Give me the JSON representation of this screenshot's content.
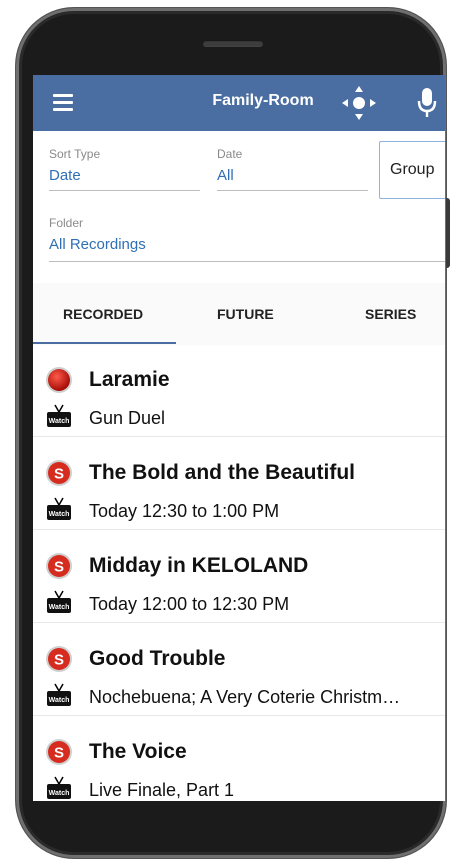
{
  "header": {
    "title": "Family-Room",
    "menu_icon": "hamburger-menu-icon",
    "remote_icon": "dpad-remote-icon",
    "voice_icon": "microphone-icon",
    "color": "#4a6ea1"
  },
  "filters": {
    "sort_type": {
      "label": "Sort Type",
      "value": "Date"
    },
    "date": {
      "label": "Date",
      "value": "All"
    },
    "group_label": "Group",
    "folder": {
      "label": "Folder",
      "value": "All Recordings"
    }
  },
  "tabs": [
    {
      "label": "RECORDED",
      "active": true
    },
    {
      "label": "FUTURE",
      "active": false
    },
    {
      "label": "SERIES",
      "active": false
    }
  ],
  "recordings": [
    {
      "title": "Laramie",
      "subtitle": "Gun Duel",
      "status_icon": "record-red-icon",
      "watch_icon": "watch-tv-icon"
    },
    {
      "title": "The Bold and the Beautiful",
      "subtitle": "Today 12:30 to 1:00 PM",
      "status_icon": "series-s-icon",
      "watch_icon": "watch-tv-icon"
    },
    {
      "title": "Midday in KELOLAND",
      "subtitle": "Today 12:00 to 12:30 PM",
      "status_icon": "series-s-icon",
      "watch_icon": "watch-tv-icon"
    },
    {
      "title": "Good Trouble",
      "subtitle": "Nochebuena; A Very Coterie Christm…",
      "status_icon": "series-s-icon",
      "watch_icon": "watch-tv-icon"
    },
    {
      "title": "The Voice",
      "subtitle": "Live Finale, Part 1",
      "status_icon": "series-s-icon",
      "watch_icon": "watch-tv-icon"
    }
  ],
  "watch_label": "Watch",
  "series_letter": "S"
}
